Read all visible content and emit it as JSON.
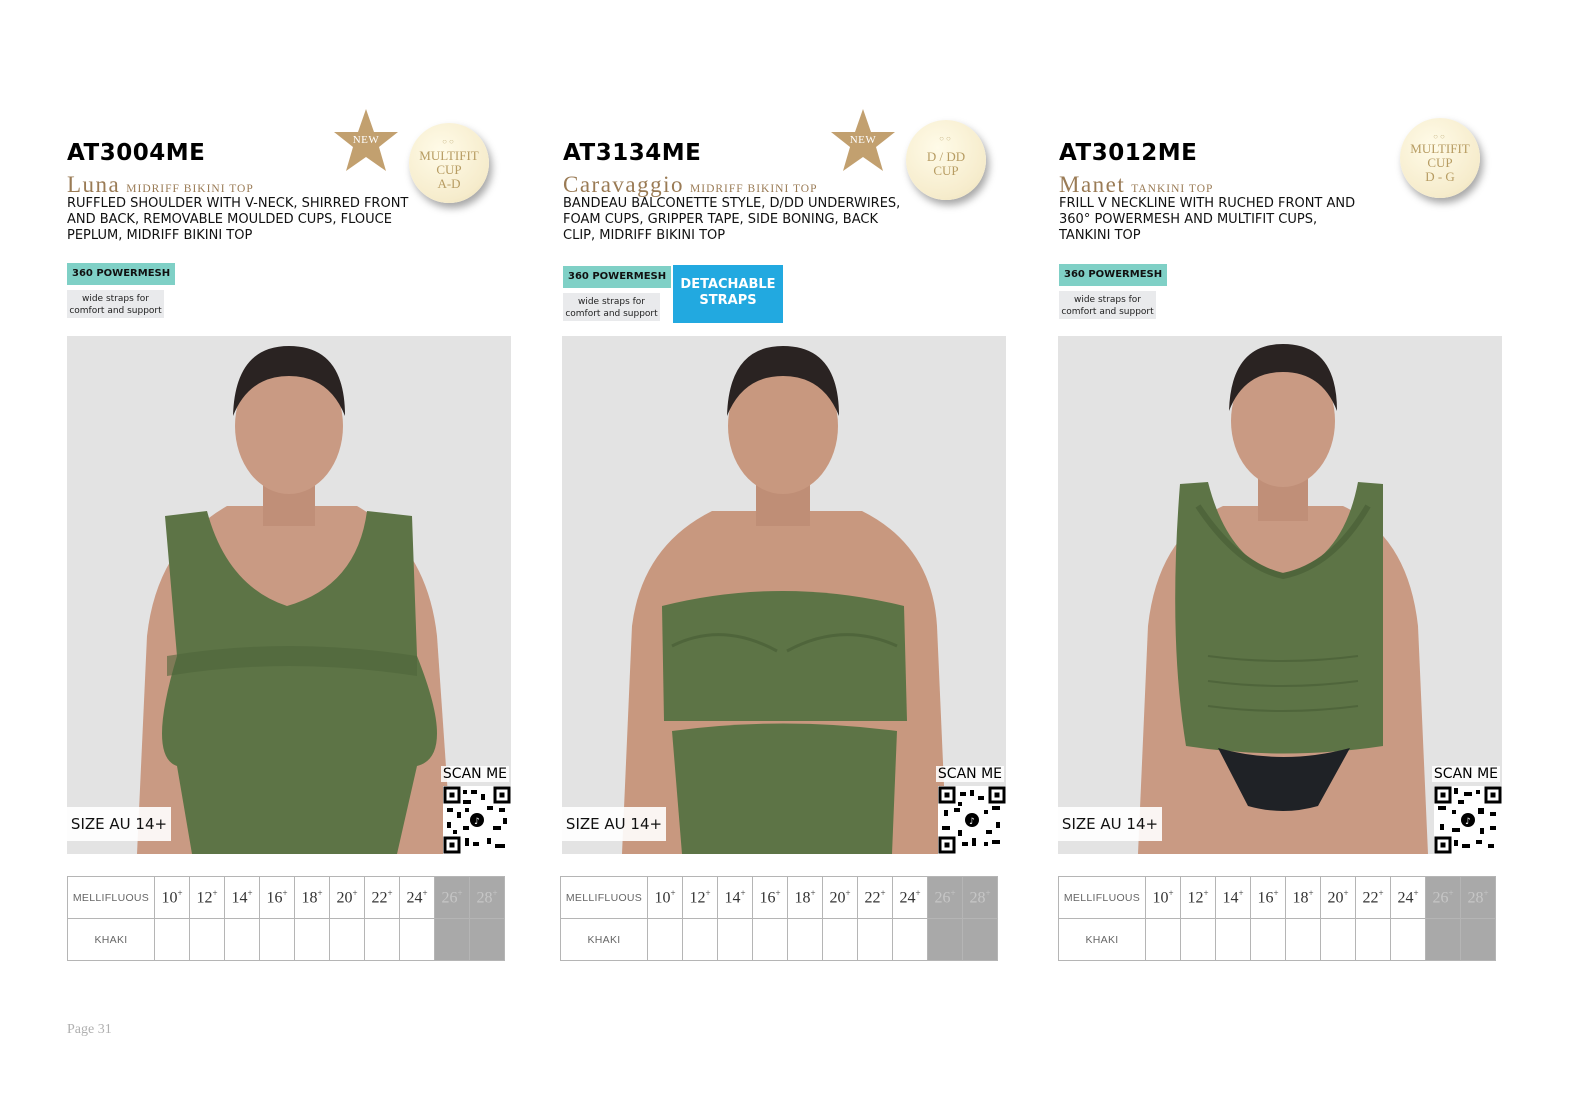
{
  "page_number": "Page 31",
  "colors": {
    "green": "#5d7446",
    "gold": "#c2a06f",
    "teal_badge": "#7fd0c6",
    "blue_badge": "#22a9e0",
    "grey_cell": "#a9a9a9"
  },
  "products": [
    {
      "code": "AT3004ME",
      "name": "Luna",
      "type": "MIDRIFF BIKINI TOP",
      "description": "RUFFLED SHOULDER WITH V-NECK, SHIRRED FRONT AND BACK, REMOVABLE MOULDED CUPS, FLOUCE PEPLUM, MIDRIFF BIKINI TOP",
      "new_badge": "NEW",
      "cup_badge": "MULTIFIT\nCUP\nA-D",
      "powermesh": "360 POWERMESH",
      "straps_note": "wide straps for comfort and support",
      "size_label": "SIZE AU 14+",
      "scan_label": "SCAN ME",
      "colour_header": "MELLIFLUOUS",
      "colour_name": "KHAKI"
    },
    {
      "code": "AT3134ME",
      "name": "Caravaggio",
      "type": "MIDRIFF BIKINI TOP",
      "description": "BANDEAU BALCONETTE STYLE, D/DD UNDERWIRES, FOAM CUPS, GRIPPER TAPE, SIDE BONING, BACK CLIP, MIDRIFF BIKINI TOP",
      "new_badge": "NEW",
      "cup_badge": "D / DD\nCUP",
      "powermesh": "360 POWERMESH",
      "straps_note": "wide straps for comfort and support",
      "detachable": "DETACHABLE STRAPS",
      "size_label": "SIZE AU 14+",
      "scan_label": "SCAN ME",
      "colour_header": "MELLIFLUOUS",
      "colour_name": "KHAKI"
    },
    {
      "code": "AT3012ME",
      "name": "Manet",
      "type": "TANKINI TOP",
      "description": "FRILL V NECKLINE WITH RUCHED FRONT AND 360° POWERMESH AND MULTIFIT CUPS, TANKINI TOP",
      "cup_badge": "MULTIFIT\nCUP\nD - G",
      "powermesh": "360 POWERMESH",
      "straps_note": "wide straps for comfort and support",
      "size_label": "SIZE AU 14+",
      "scan_label": "SCAN ME",
      "colour_header": "MELLIFLUOUS",
      "colour_name": "KHAKI"
    }
  ],
  "sizes": [
    "10",
    "12",
    "14",
    "16",
    "18",
    "20",
    "22",
    "24",
    "26",
    "28"
  ],
  "unavailable_sizes": [
    "26",
    "28"
  ]
}
